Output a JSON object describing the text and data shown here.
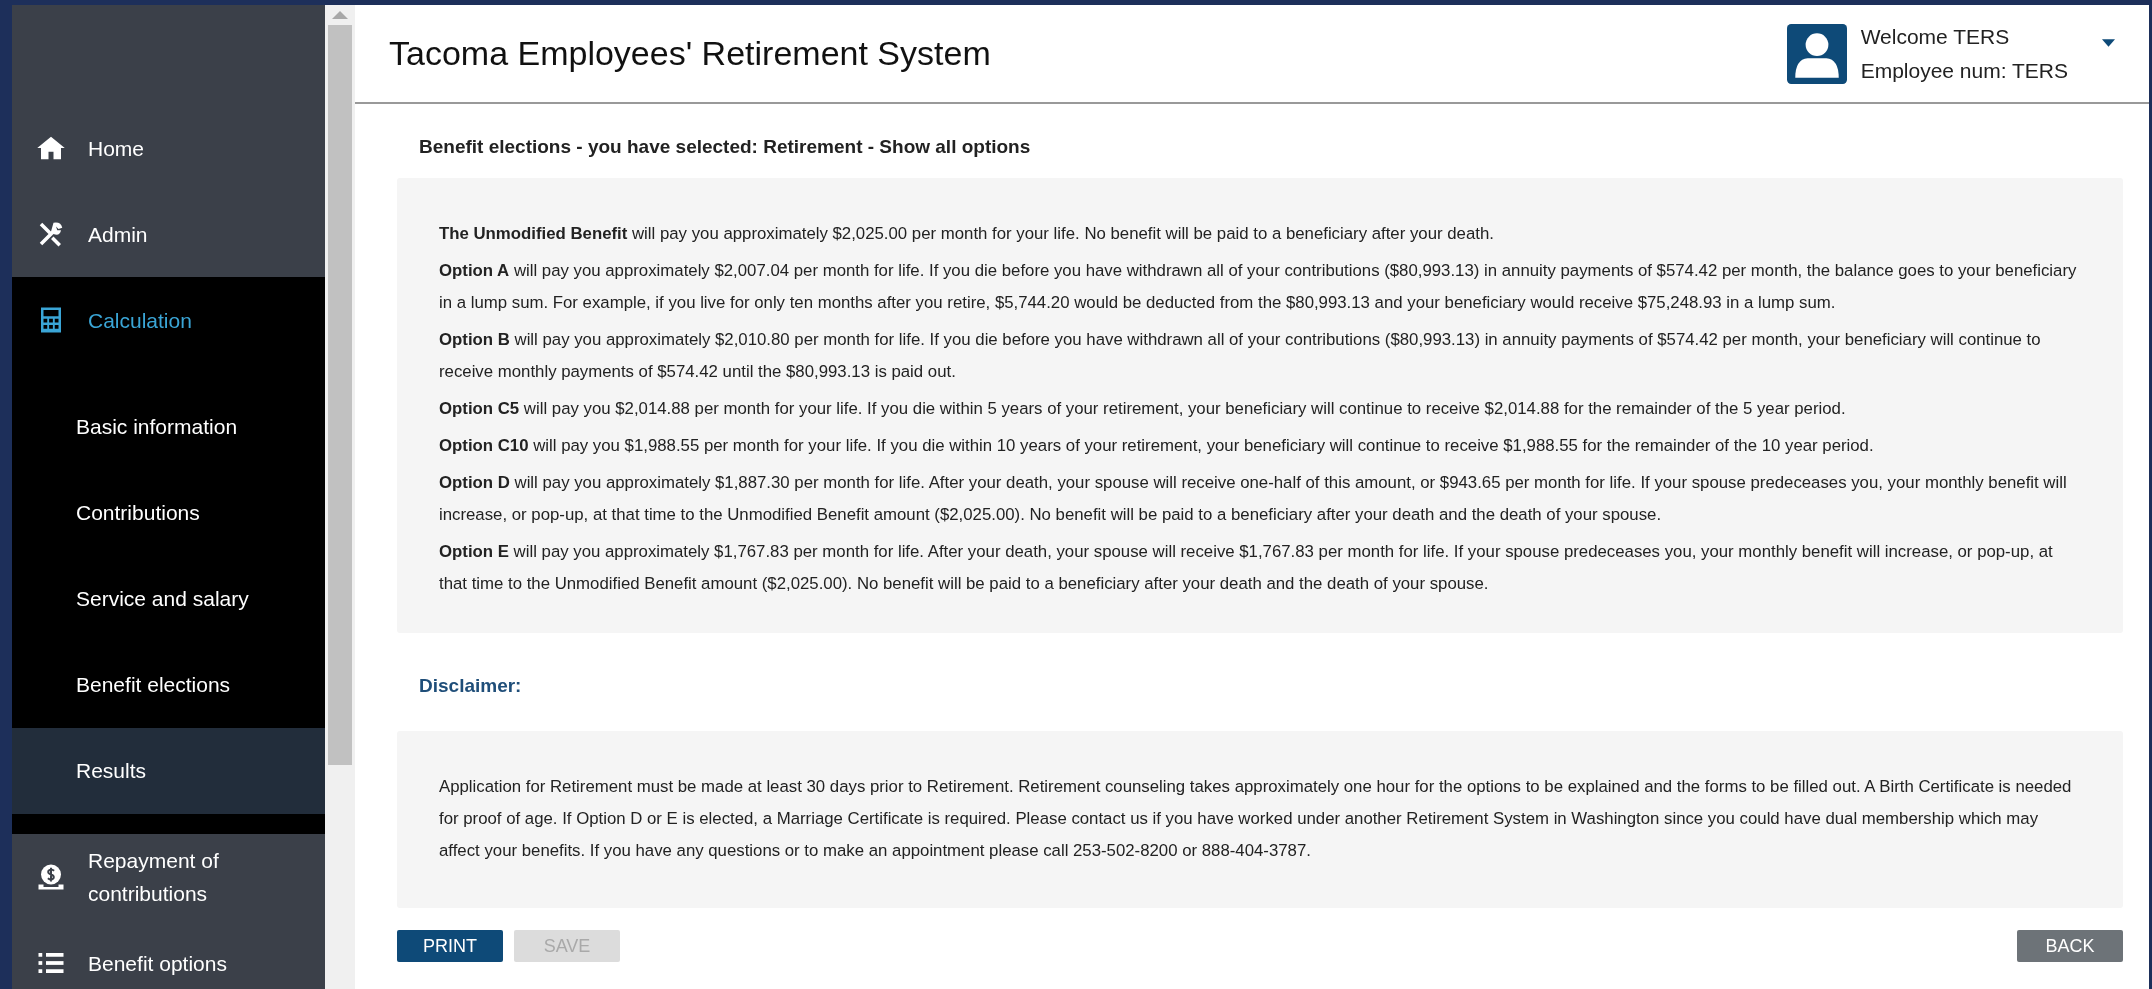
{
  "sidebar": {
    "items": [
      {
        "label": "Home",
        "selected": false
      },
      {
        "label": "Admin",
        "selected": false
      },
      {
        "label": "Calculation",
        "selected": true,
        "expanded": true,
        "children": [
          {
            "label": "Basic information",
            "selected": false
          },
          {
            "label": "Contributions",
            "selected": false
          },
          {
            "label": "Service and salary",
            "selected": false
          },
          {
            "label": "Benefit elections",
            "selected": false
          },
          {
            "label": "Results",
            "selected": true
          }
        ]
      },
      {
        "label": "Repayment of contributions",
        "selected": false
      },
      {
        "label": "Benefit options",
        "selected": false
      }
    ]
  },
  "header": {
    "title": "Tacoma Employees' Retirement System",
    "welcome": "Welcome TERS",
    "employee": "Employee num: TERS"
  },
  "elections": {
    "heading": "Benefit elections - you have selected: Retirement - Show all options",
    "paragraphs": [
      "**The Unmodified Benefit** will pay you approximately $2,025.00 per month for your life. No benefit will be paid to a beneficiary after your death.",
      "**Option A** will pay you approximately $2,007.04 per month for life. If you die before you have withdrawn all of your contributions ($80,993.13) in annuity payments of $574.42 per month, the balance goes to your beneficiary in a lump sum. For example, if you live for only ten months after you retire, $5,744.20 would be deducted from the $80,993.13 and your beneficiary would receive $75,248.93 in a lump sum.",
      "**Option B** will pay you approximately $2,010.80 per month for life. If you die before you have withdrawn all of your contributions ($80,993.13) in annuity payments of $574.42 per month, your beneficiary will continue to receive monthly payments of $574.42 until the $80,993.13 is paid out.",
      "**Option C5** will pay you $2,014.88 per month for your life. If you die within 5 years of your retirement, your beneficiary will continue to receive $2,014.88 for the remainder of the 5 year period.",
      "**Option C10** will pay you $1,988.55 per month for your life. If you die within 10 years of your retirement, your beneficiary will continue to receive $1,988.55 for the remainder of the 10 year period.",
      "**Option D** will pay you approximately $1,887.30 per month for life. After your death, your spouse will receive one-half of this amount, or $943.65 per month for life. If your spouse predeceases you, your monthly benefit will increase, or pop-up, at that time to the Unmodified Benefit amount ($2,025.00). No benefit will be paid to a beneficiary after your death and the death of your spouse.",
      "**Option E** will pay you approximately $1,767.83 per month for life. After your death, your spouse will receive $1,767.83 per month for life. If your spouse predeceases you, your monthly benefit will increase, or pop-up, at that time to the Unmodified Benefit amount ($2,025.00). No benefit will be paid to a beneficiary after your death and the death of your spouse."
    ]
  },
  "disclaimer": {
    "heading": "Disclaimer:",
    "text": "Application for Retirement must be made at least 30 days prior to Retirement. Retirement counseling takes approximately one hour for the options to be explained and the forms to be filled out. A Birth Certificate is needed for proof of age. If Option D or E is elected, a Marriage Certificate is required. Please contact us if you have worked under another Retirement System in Washington since you could have dual membership which may affect your benefits. If you have any questions or to make an appointment please call 253-502-8200 or 888-404-3787."
  },
  "buttons": [
    {
      "label": "PRINT",
      "kind": "primary",
      "disabled": false
    },
    {
      "label": "SAVE",
      "kind": "primary",
      "disabled": true
    },
    {
      "label": "BACK",
      "kind": "secondary",
      "disabled": false
    }
  ]
}
